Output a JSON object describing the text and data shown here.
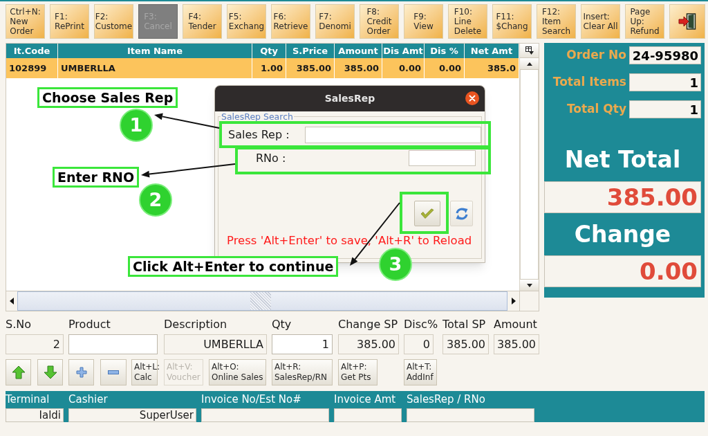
{
  "toolbar": [
    {
      "lines": [
        "Ctrl+N:",
        "New",
        "Order"
      ],
      "disabled": false
    },
    {
      "lines": [
        "F1:",
        "RePrint"
      ],
      "disabled": false
    },
    {
      "lines": [
        "F2:",
        "Custome"
      ],
      "disabled": false
    },
    {
      "lines": [
        "F3:",
        "Cancel"
      ],
      "disabled": true
    },
    {
      "lines": [
        "F4:",
        "Tender"
      ],
      "disabled": false
    },
    {
      "lines": [
        "F5:",
        "Exchang"
      ],
      "disabled": false
    },
    {
      "lines": [
        "F6:",
        "Retrieve"
      ],
      "disabled": false
    },
    {
      "lines": [
        "F7:",
        "Denomi"
      ],
      "disabled": false
    },
    {
      "lines": [
        "F8:",
        "Credit",
        "Order"
      ],
      "disabled": false
    },
    {
      "lines": [
        "F9:",
        "View"
      ],
      "disabled": false
    },
    {
      "lines": [
        "F10:",
        "Line",
        "Delete"
      ],
      "disabled": false
    },
    {
      "lines": [
        "F11:",
        "$Chang"
      ],
      "disabled": false
    },
    {
      "lines": [
        "F12:",
        "Item",
        "Search"
      ],
      "disabled": false
    },
    {
      "lines": [
        "Insert:",
        "Clear All"
      ],
      "disabled": false
    },
    {
      "lines": [
        "Page",
        "Up:",
        "Refund"
      ],
      "disabled": false
    }
  ],
  "order_table": {
    "columns": [
      "It.Code",
      "Item Name",
      "Qty",
      "S.Price",
      "Amount",
      "Dis Amt",
      "Dis %",
      "Net Amt"
    ],
    "rows": [
      {
        "cells": [
          "102899",
          "UMBERLLA",
          "1.00",
          "385.00",
          "385.00",
          "0.00",
          "0.00",
          "385.0"
        ],
        "selected": true
      }
    ]
  },
  "summary": {
    "fields": [
      {
        "label": "Order No",
        "value": "24-95980"
      },
      {
        "label": "Total Items",
        "value": "1"
      },
      {
        "label": "Total Qty",
        "value": "1"
      }
    ],
    "totals": [
      {
        "label": "Net Total",
        "value": "385.00"
      },
      {
        "label": "Change",
        "value": "0.00"
      }
    ]
  },
  "entry_form": {
    "labels": [
      "S.No",
      "Product",
      "Description",
      "Qty",
      "Change SP",
      "Disc%",
      "Total SP",
      "Amount"
    ],
    "fields": [
      {
        "value": "2",
        "editable": false
      },
      {
        "editable": true
      },
      {
        "value": "UMBERLLA",
        "editable": false
      },
      {
        "value": "1",
        "editable": true
      },
      {
        "value": "385.00",
        "editable": false
      },
      {
        "value": "0",
        "editable": false
      },
      {
        "value": "385.00",
        "editable": false
      },
      {
        "value": "385.00",
        "editable": false
      }
    ],
    "buttons": [
      {
        "lines": [
          "Alt+L:",
          "Calc"
        ],
        "disabled": false
      },
      {
        "lines": [
          "Alt+V:",
          "Voucher"
        ],
        "disabled": true
      },
      {
        "lines": [
          "Alt+O:",
          "Online Sales"
        ],
        "disabled": false
      },
      {
        "lines": [
          "Alt+R:",
          "SalesRep/RN"
        ],
        "disabled": false
      },
      {
        "lines": [
          "Alt+P:",
          "Get Pts"
        ],
        "disabled": false
      },
      {
        "lines": [
          "Alt+T:",
          "AddInf"
        ],
        "disabled": false
      }
    ]
  },
  "status_bar": {
    "labels": [
      "Terminal",
      "Cashier",
      "Invoice No/Est No#",
      "Invoice Amt",
      "SalesRep / RNo"
    ],
    "values": [
      "Ialdi",
      "SuperUser"
    ]
  },
  "dialog": {
    "title": "SalesRep",
    "group": "SalesRep Search",
    "fields": [
      {
        "label": "Sales Rep :"
      },
      {
        "label": "RNo :"
      }
    ],
    "hint": "Press 'Alt+Enter' to save, 'Alt+R' to Reload"
  },
  "annotations": [
    {
      "step": "1",
      "callout": "Choose Sales Rep"
    },
    {
      "step": "2",
      "callout": "Enter RNO"
    },
    {
      "step": "3",
      "callout": "Click Alt+Enter to continue"
    }
  ]
}
